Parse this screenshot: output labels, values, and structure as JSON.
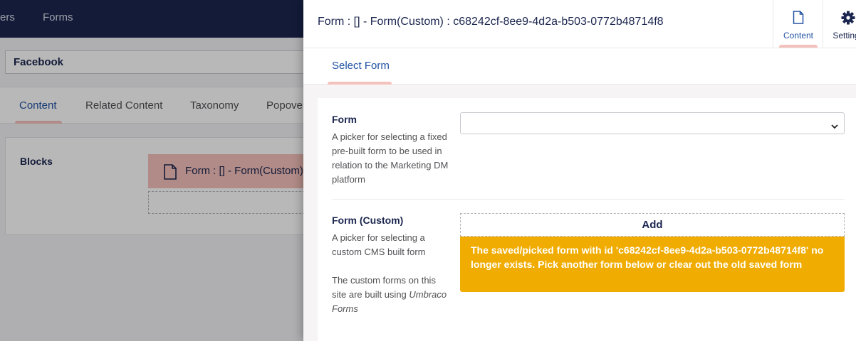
{
  "topnav": {
    "items": [
      {
        "label": "ers"
      },
      {
        "label": "Forms"
      }
    ]
  },
  "editor": {
    "name_value": "Facebook",
    "tabs": [
      {
        "label": "Content"
      },
      {
        "label": "Related Content"
      },
      {
        "label": "Taxonomy"
      },
      {
        "label": "Popover"
      }
    ],
    "blocks_label": "Blocks",
    "block_item_label": "Form : [] - Form(Custom) :"
  },
  "panel": {
    "title": "Form : [] - Form(Custom) : c68242cf-8ee9-4d2a-b503-0772b48714f8",
    "apps": [
      {
        "label": "Content",
        "icon": "document-icon"
      },
      {
        "label": "Settings",
        "icon": "gear-icon"
      }
    ],
    "subtab_label": "Select Form",
    "properties": [
      {
        "label": "Form",
        "description": "A picker for selecting a fixed pre-built form to be used in relation to the Marketing DM platform",
        "select_value": ""
      },
      {
        "label": "Form (Custom)",
        "description_1": "A picker for selecting a custom CMS built form",
        "description_2_prefix": "The custom forms on this site are built using ",
        "description_2_em": "Umbraco Forms",
        "add_label": "Add",
        "warning": "The saved/picked form with id 'c68242cf-8ee9-4d2a-b503-0772b48714f8' no longer exists. Pick another form below or clear out the old saved form"
      }
    ]
  },
  "colors": {
    "nav_bg": "#1b264f",
    "accent_blue": "#2152a3",
    "active_underline": "#f5c1bc",
    "warning_bg": "#f0ac00"
  }
}
